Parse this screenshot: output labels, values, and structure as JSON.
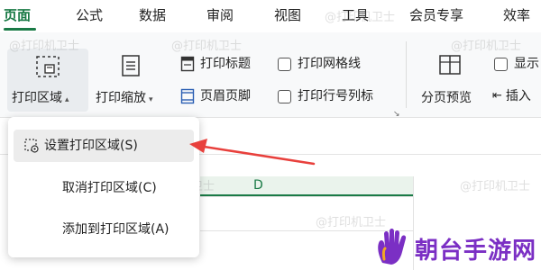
{
  "menu": {
    "items": [
      "页面",
      "公式",
      "数据",
      "审阅",
      "视图",
      "工具",
      "会员专享",
      "效率"
    ],
    "active_index": 0
  },
  "ribbon": {
    "print_area": "打印区域",
    "print_scale": "打印缩放",
    "print_titles": "打印标题",
    "header_footer": "页眉页脚",
    "print_gridlines": "打印网格线",
    "print_row_col_headers": "打印行号列标",
    "page_break_preview": "分页预览",
    "show_partial": "显示",
    "insert_partial": "插入"
  },
  "dropdown": {
    "items": [
      "设置打印区域(S)",
      "取消打印区域(C)",
      "添加到打印区域(A)"
    ],
    "hover_index": 0
  },
  "sheet": {
    "column_letter": "D"
  },
  "watermark": "@打印机卫士",
  "brand": {
    "text": "朝台手游网",
    "color": "#7b2fc4"
  },
  "colors": {
    "accent": "#1a7a46",
    "arrow": "#e8403c"
  }
}
